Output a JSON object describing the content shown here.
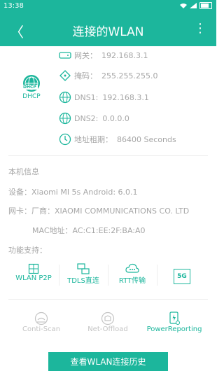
{
  "statusbar": {
    "time": "13:38"
  },
  "appbar": {
    "title": "连接的WLAN",
    "back_glyph": "〈",
    "more_glyph": "⋮"
  },
  "dhcp": {
    "badge": "DHCP",
    "label": "DHCP"
  },
  "network": {
    "gateway": {
      "label": "网关：",
      "value": "192.168.3.1"
    },
    "mask": {
      "label": "掩码：",
      "value": "255.255.255.0"
    },
    "dns1": {
      "label": "DNS1:",
      "value": "192.168.3.1"
    },
    "dns2": {
      "label": "DNS2:",
      "value": "0.0.0.0"
    },
    "lease": {
      "label": "地址租期：",
      "value": "86400 Seconds"
    }
  },
  "device": {
    "section_title": "本机信息",
    "device_label": "设备：",
    "device_value": "Xiaomi MI 5s Android: 6.0.1",
    "nic_label": "网卡：",
    "vendor_label": "厂商：",
    "vendor_value": "XIAOMI COMMUNICATIONS CO. LTD",
    "mac_label": "MAC地址：",
    "mac_value": "AC:C1:EE:2F:BA:A0"
  },
  "features": {
    "title": "功能支持：",
    "items": [
      "WLAN P2P",
      "TDLS直连",
      "RTT传输"
    ],
    "badge": "5G"
  },
  "tools": [
    {
      "label": "Conti-Scan",
      "icon": "scan-icon",
      "active": false
    },
    {
      "label": "Net-Offload",
      "icon": "offload-icon",
      "active": false
    },
    {
      "label": "PowerReporting",
      "icon": "power-report-icon",
      "active": true
    }
  ],
  "colors": {
    "accent": "#1cb69c",
    "text_muted": "#a6a6a6",
    "inactive": "#c4c4c4"
  },
  "history_button": "查看WLAN连接历史"
}
